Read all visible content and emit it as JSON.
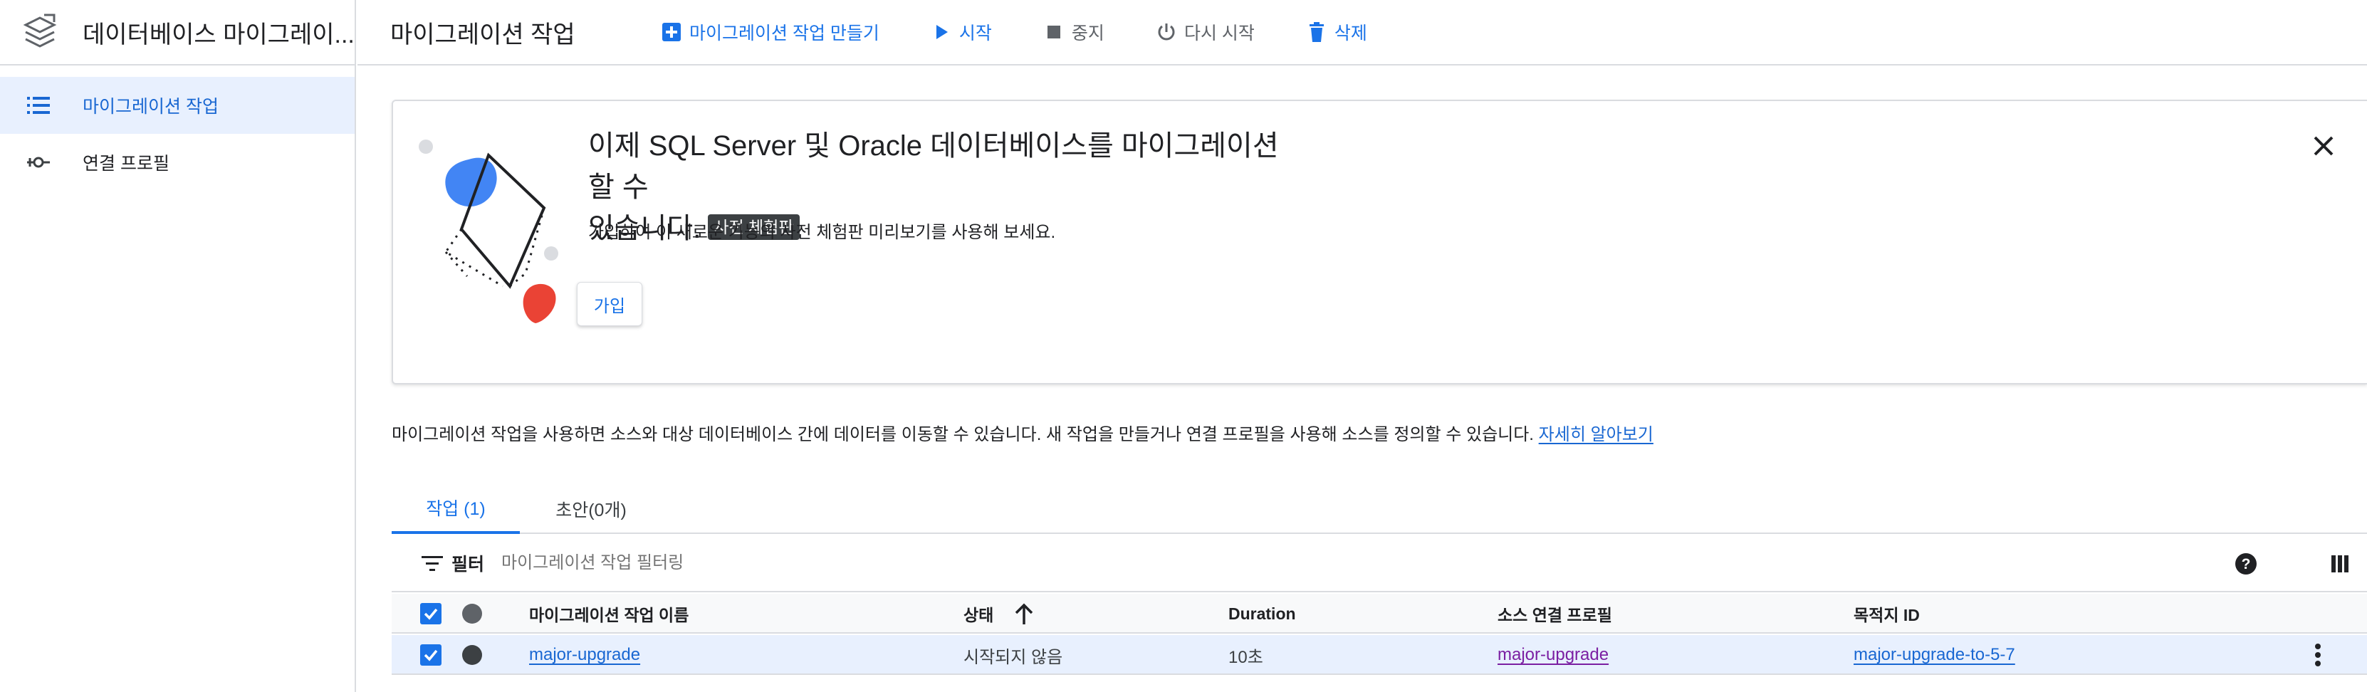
{
  "app": {
    "title": "데이터베이스 마이그레이..."
  },
  "sidebar": {
    "items": [
      {
        "label": "마이그레이션 작업",
        "icon": "list-icon",
        "active": true
      },
      {
        "label": "연결 프로필",
        "icon": "connection-icon",
        "active": false
      }
    ]
  },
  "toolbar": {
    "page_title": "마이그레이션 작업",
    "create_label": "마이그레이션 작업 만들기",
    "start_label": "시작",
    "stop_label": "중지",
    "restart_label": "다시 시작",
    "delete_label": "삭제"
  },
  "banner": {
    "headline_line1": "이제 SQL Server 및 Oracle 데이터베이스를 마이그레이션할 수",
    "headline_line2": "있습니다.",
    "badge": "사전 체험판",
    "description": "가입하여 이 새로운 기능의 사전 체험판 미리보기를 사용해 보세요.",
    "join_label": "가입"
  },
  "info": {
    "text": "마이그레이션 작업을 사용하면 소스와 대상 데이터베이스 간에 데이터를 이동할 수 있습니다. 새 작업을 만들거나 연결 프로필을 사용해 소스를 정의할 수 있습니다.",
    "link": "자세히 알아보기"
  },
  "tabs": [
    {
      "label": "작업 (1)",
      "active": true
    },
    {
      "label": "초안(0개)",
      "active": false
    }
  ],
  "filter": {
    "label": "필터",
    "placeholder": "마이그레이션 작업 필터링"
  },
  "table": {
    "columns": {
      "name": "마이그레이션 작업 이름",
      "status": "상태",
      "duration": "Duration",
      "source": "소스 연결 프로필",
      "destination": "목적지 ID"
    },
    "sort_direction": "ascending",
    "rows": [
      {
        "name": "major-upgrade",
        "status": "시작되지 않음",
        "duration": "10초",
        "source": "major-upgrade",
        "destination": "major-upgrade-to-5-7",
        "selected": true
      }
    ]
  },
  "colors": {
    "accent": "#1a73e8",
    "link": "#1967d2",
    "visited_link": "#7b1fa2",
    "selected_bg": "#e8f0fe",
    "badge_bg": "#3c4043",
    "art_blue": "#4285f4",
    "art_red": "#ea4335"
  }
}
